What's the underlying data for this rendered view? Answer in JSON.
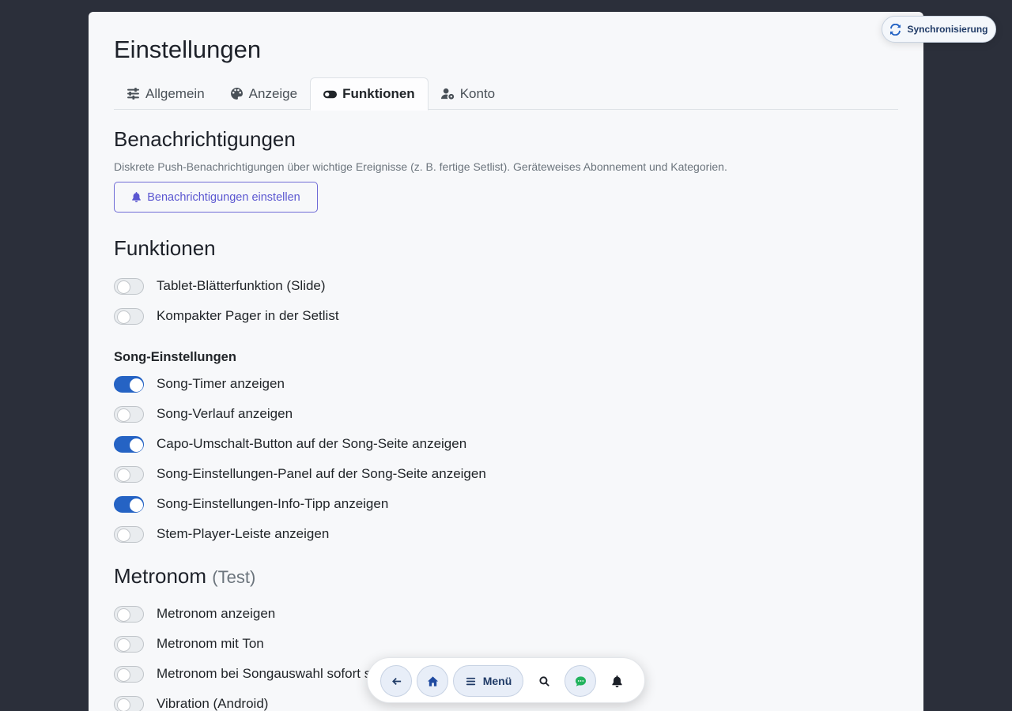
{
  "page": {
    "title": "Einstellungen"
  },
  "tabs": [
    {
      "label": "Allgemein",
      "icon": "sliders-icon"
    },
    {
      "label": "Anzeige",
      "icon": "palette-icon"
    },
    {
      "label": "Funktionen",
      "icon": "toggle-icon",
      "active": true
    },
    {
      "label": "Konto",
      "icon": "user-gear-icon"
    }
  ],
  "notifications": {
    "title": "Benachrichtigungen",
    "description": "Diskrete Push-Benachrichtigungen über wichtige Ereignisse (z. B. fertige Setlist). Geräteweises Abonnement und Kategorien.",
    "button_label": "Benachrichtigungen einstellen"
  },
  "functions": {
    "title": "Funktionen",
    "toggles": [
      {
        "label": "Tablet-Blätterfunktion (Slide)",
        "on": false
      },
      {
        "label": "Kompakter Pager in der Setlist",
        "on": false
      }
    ]
  },
  "song_settings": {
    "title": "Song-Einstellungen",
    "toggles": [
      {
        "label": "Song-Timer anzeigen",
        "on": true
      },
      {
        "label": "Song-Verlauf anzeigen",
        "on": false
      },
      {
        "label": "Capo-Umschalt-Button auf der Song-Seite anzeigen",
        "on": true
      },
      {
        "label": "Song-Einstellungen-Panel auf der Song-Seite anzeigen",
        "on": false
      },
      {
        "label": "Song-Einstellungen-Info-Tipp anzeigen",
        "on": true
      },
      {
        "label": "Stem-Player-Leiste anzeigen",
        "on": false
      }
    ]
  },
  "metronome": {
    "title": "Metronom",
    "suffix": "(Test)",
    "toggles": [
      {
        "label": "Metronom anzeigen",
        "on": false
      },
      {
        "label": "Metronom mit Ton",
        "on": false
      },
      {
        "label": "Metronom bei Songauswahl sofort starten",
        "on": false
      },
      {
        "label": "Vibration (Android)",
        "on": false
      }
    ]
  },
  "sync": {
    "label": "Synchronisierung"
  },
  "bottom_nav": {
    "menu_label": "Menü"
  },
  "colors": {
    "accent": "#2563c4",
    "outline_button": "#5b57d1",
    "background": "#2b2f3a",
    "card": "#f7f8fa"
  }
}
